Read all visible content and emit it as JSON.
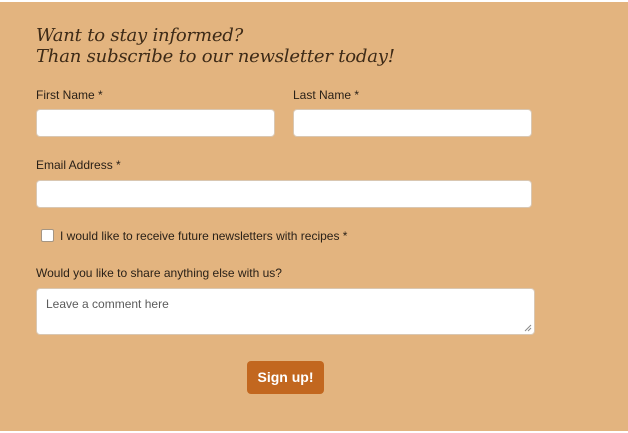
{
  "form": {
    "heading_line1": "Want to stay informed?",
    "heading_line2": "Than subscribe to our newsletter today!",
    "first_name_label": "First Name *",
    "first_name_value": "",
    "last_name_label": "Last Name *",
    "last_name_value": "",
    "email_label": "Email Address *",
    "email_value": "",
    "newsletter_checkbox_label": "I would like to receive future newsletters with recipes *",
    "newsletter_checked": false,
    "comment_label": "Would you like to share anything else with us?",
    "comment_placeholder": "Leave a comment here",
    "submit_label": "Sign up!"
  },
  "colors": {
    "panel_background": "#e3b47f",
    "button_background": "#c2671f",
    "button_text": "#ffffff",
    "heading_text": "#3d2a17"
  }
}
